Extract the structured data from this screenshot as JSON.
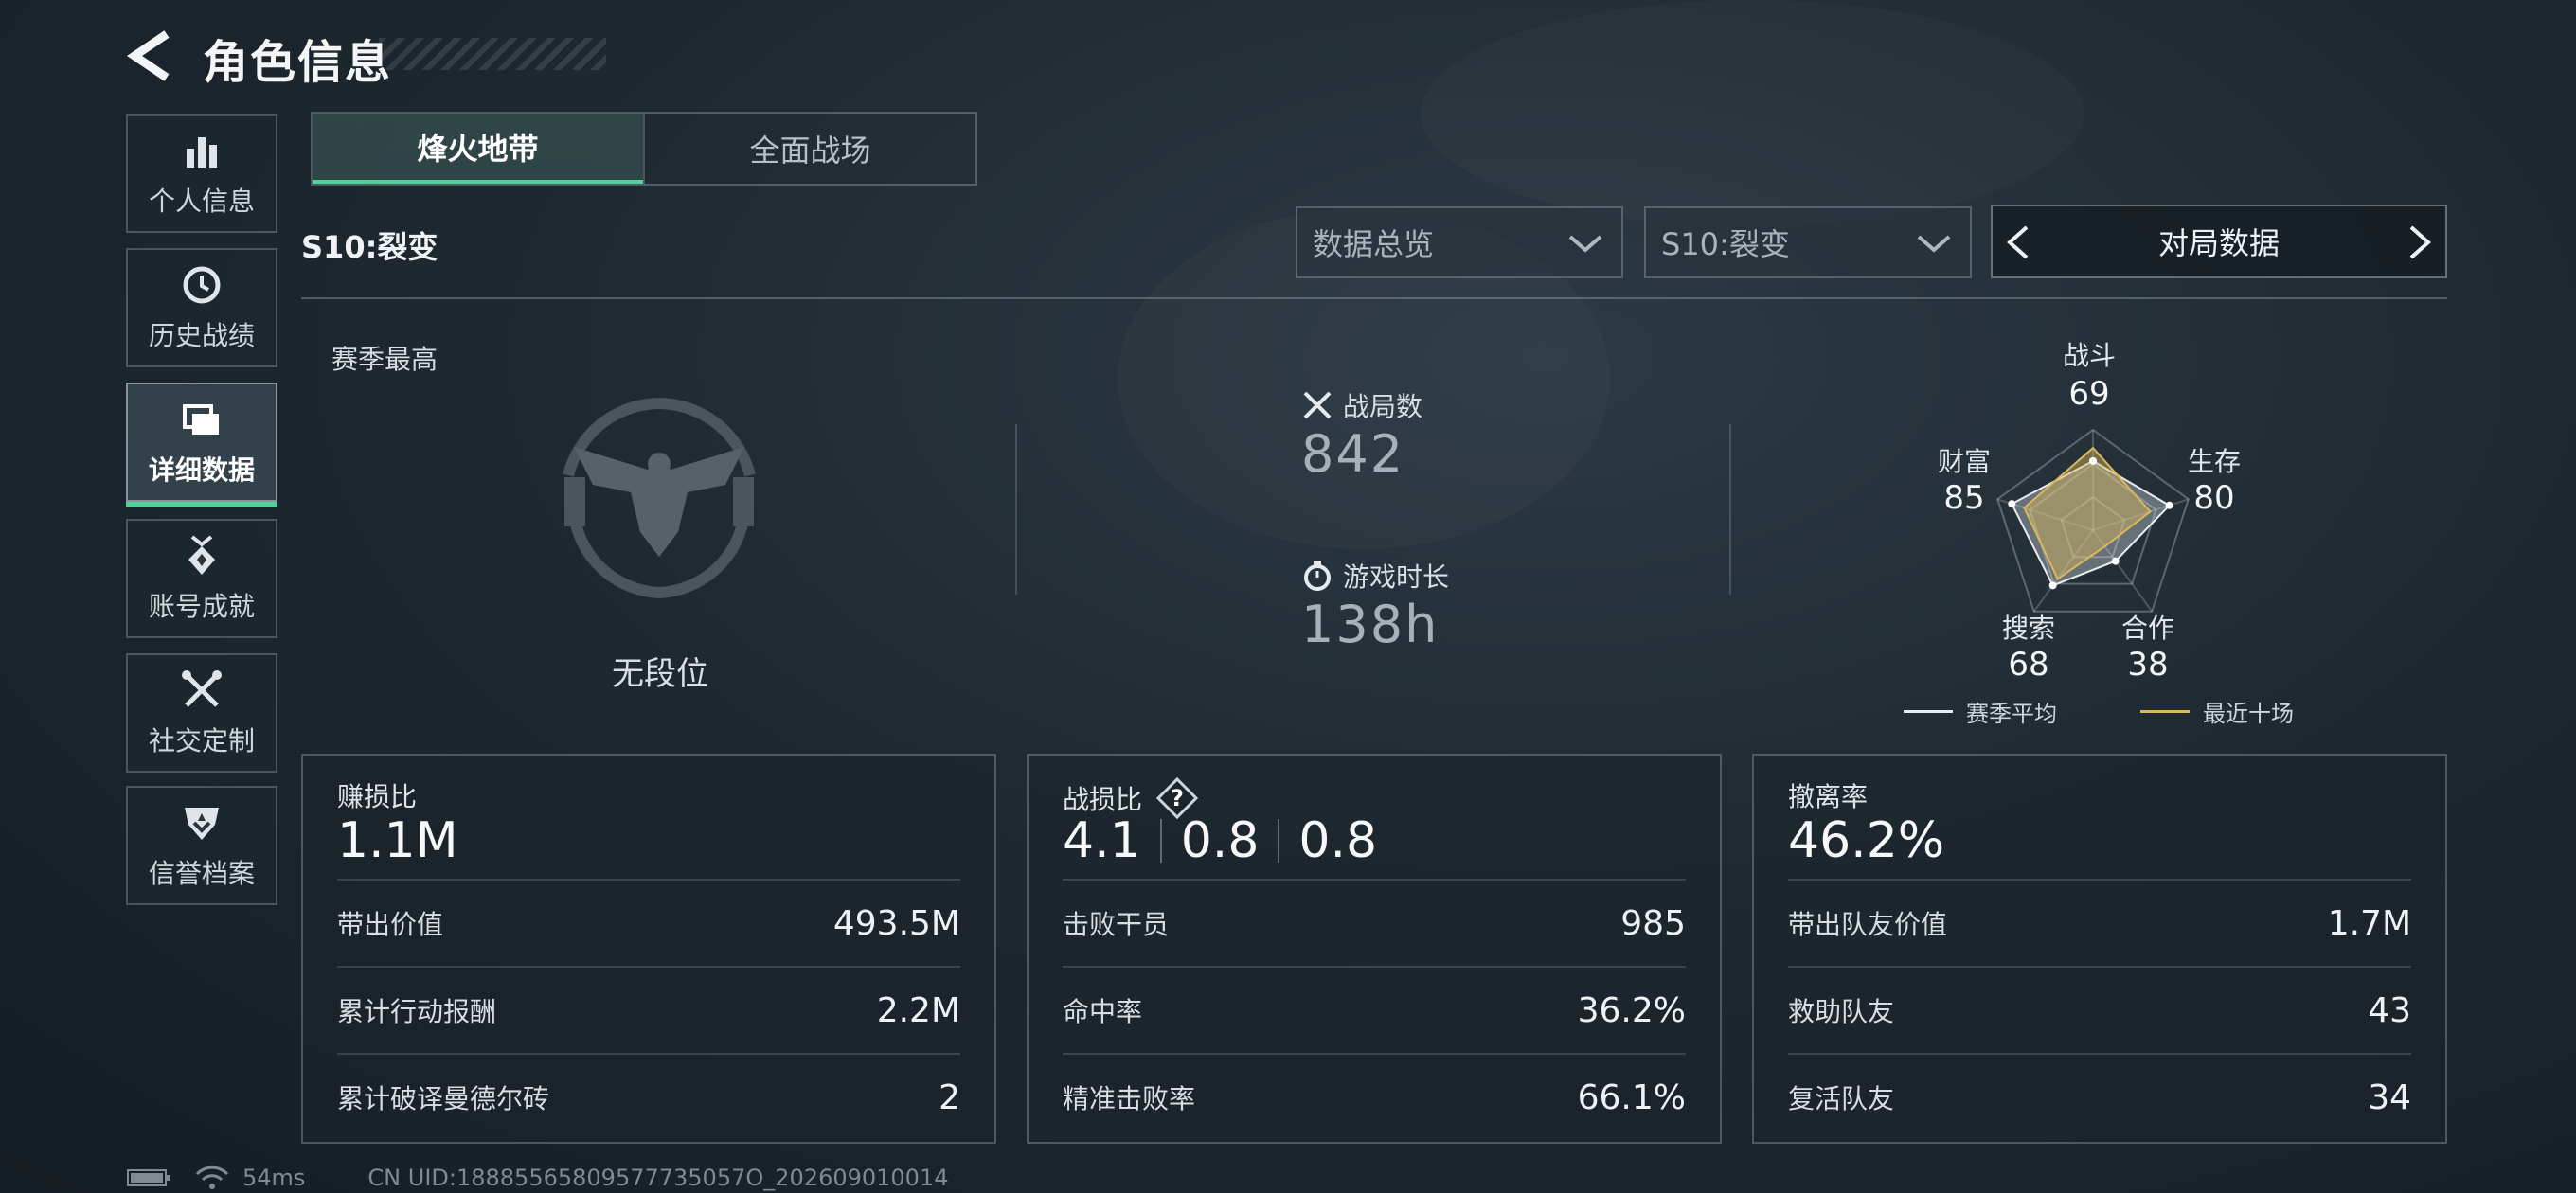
{
  "header": {
    "title": "角色信息"
  },
  "sidebar": {
    "items": [
      {
        "label": "个人信息",
        "icon": "bar-chart-icon"
      },
      {
        "label": "历史战绩",
        "icon": "history-clock-icon"
      },
      {
        "label": "详细数据",
        "icon": "folders-icon",
        "active": true
      },
      {
        "label": "账号成就",
        "icon": "medal-icon"
      },
      {
        "label": "社交定制",
        "icon": "tools-icon"
      },
      {
        "label": "信誉档案",
        "icon": "shield-badge-icon"
      }
    ]
  },
  "tabs": [
    {
      "label": "烽火地带",
      "active": true
    },
    {
      "label": "全面战场"
    }
  ],
  "season_label": "S10:裂变",
  "filters": {
    "overview": "数据总览",
    "season": "S10:裂变",
    "pager_label": "对局数据"
  },
  "rank": {
    "section_label": "赛季最高",
    "rank_name": "无段位",
    "emblem_icon": "eagle-emblem-icon"
  },
  "matches": {
    "label": "战局数",
    "value": "842",
    "icon": "crossed-swords-icon"
  },
  "playtime": {
    "label": "游戏时长",
    "value": "138h",
    "icon": "stopwatch-icon"
  },
  "radar": {
    "axes": [
      {
        "label": "战斗",
        "value": "69"
      },
      {
        "label": "生存",
        "value": "80"
      },
      {
        "label": "合作",
        "value": "38"
      },
      {
        "label": "搜索",
        "value": "68"
      },
      {
        "label": "财富",
        "value": "85"
      }
    ],
    "legend": {
      "season_avg": "赛季平均",
      "recent_ten": "最近十场"
    },
    "colors": {
      "season_avg": "#e8ecef",
      "recent_ten": "#d9b85a"
    },
    "recent_values": [
      82,
      60,
      20,
      60,
      72
    ]
  },
  "panels": {
    "profit": {
      "title": "赚损比",
      "main": "1.1M",
      "rows": [
        {
          "k": "带出价值",
          "v": "493.5M"
        },
        {
          "k": "累计行动报酬",
          "v": "2.2M"
        },
        {
          "k": "累计破译曼德尔砖",
          "v": "2"
        }
      ]
    },
    "combat": {
      "title": "战损比",
      "values": [
        "4.1",
        "0.8",
        "0.8"
      ],
      "help_icon": "question-icon",
      "rows": [
        {
          "k": "击败干员",
          "v": "985"
        },
        {
          "k": "命中率",
          "v": "36.2%"
        },
        {
          "k": "精准击败率",
          "v": "66.1%"
        }
      ]
    },
    "extract": {
      "title": "撤离率",
      "main": "46.2%",
      "rows": [
        {
          "k": "带出队友价值",
          "v": "1.7M"
        },
        {
          "k": "救助队友",
          "v": "43"
        },
        {
          "k": "复活队友",
          "v": "34"
        }
      ]
    }
  },
  "footer": {
    "ping": "54ms",
    "uid": "CN UID:18885565809577735057O_202609010014"
  }
}
